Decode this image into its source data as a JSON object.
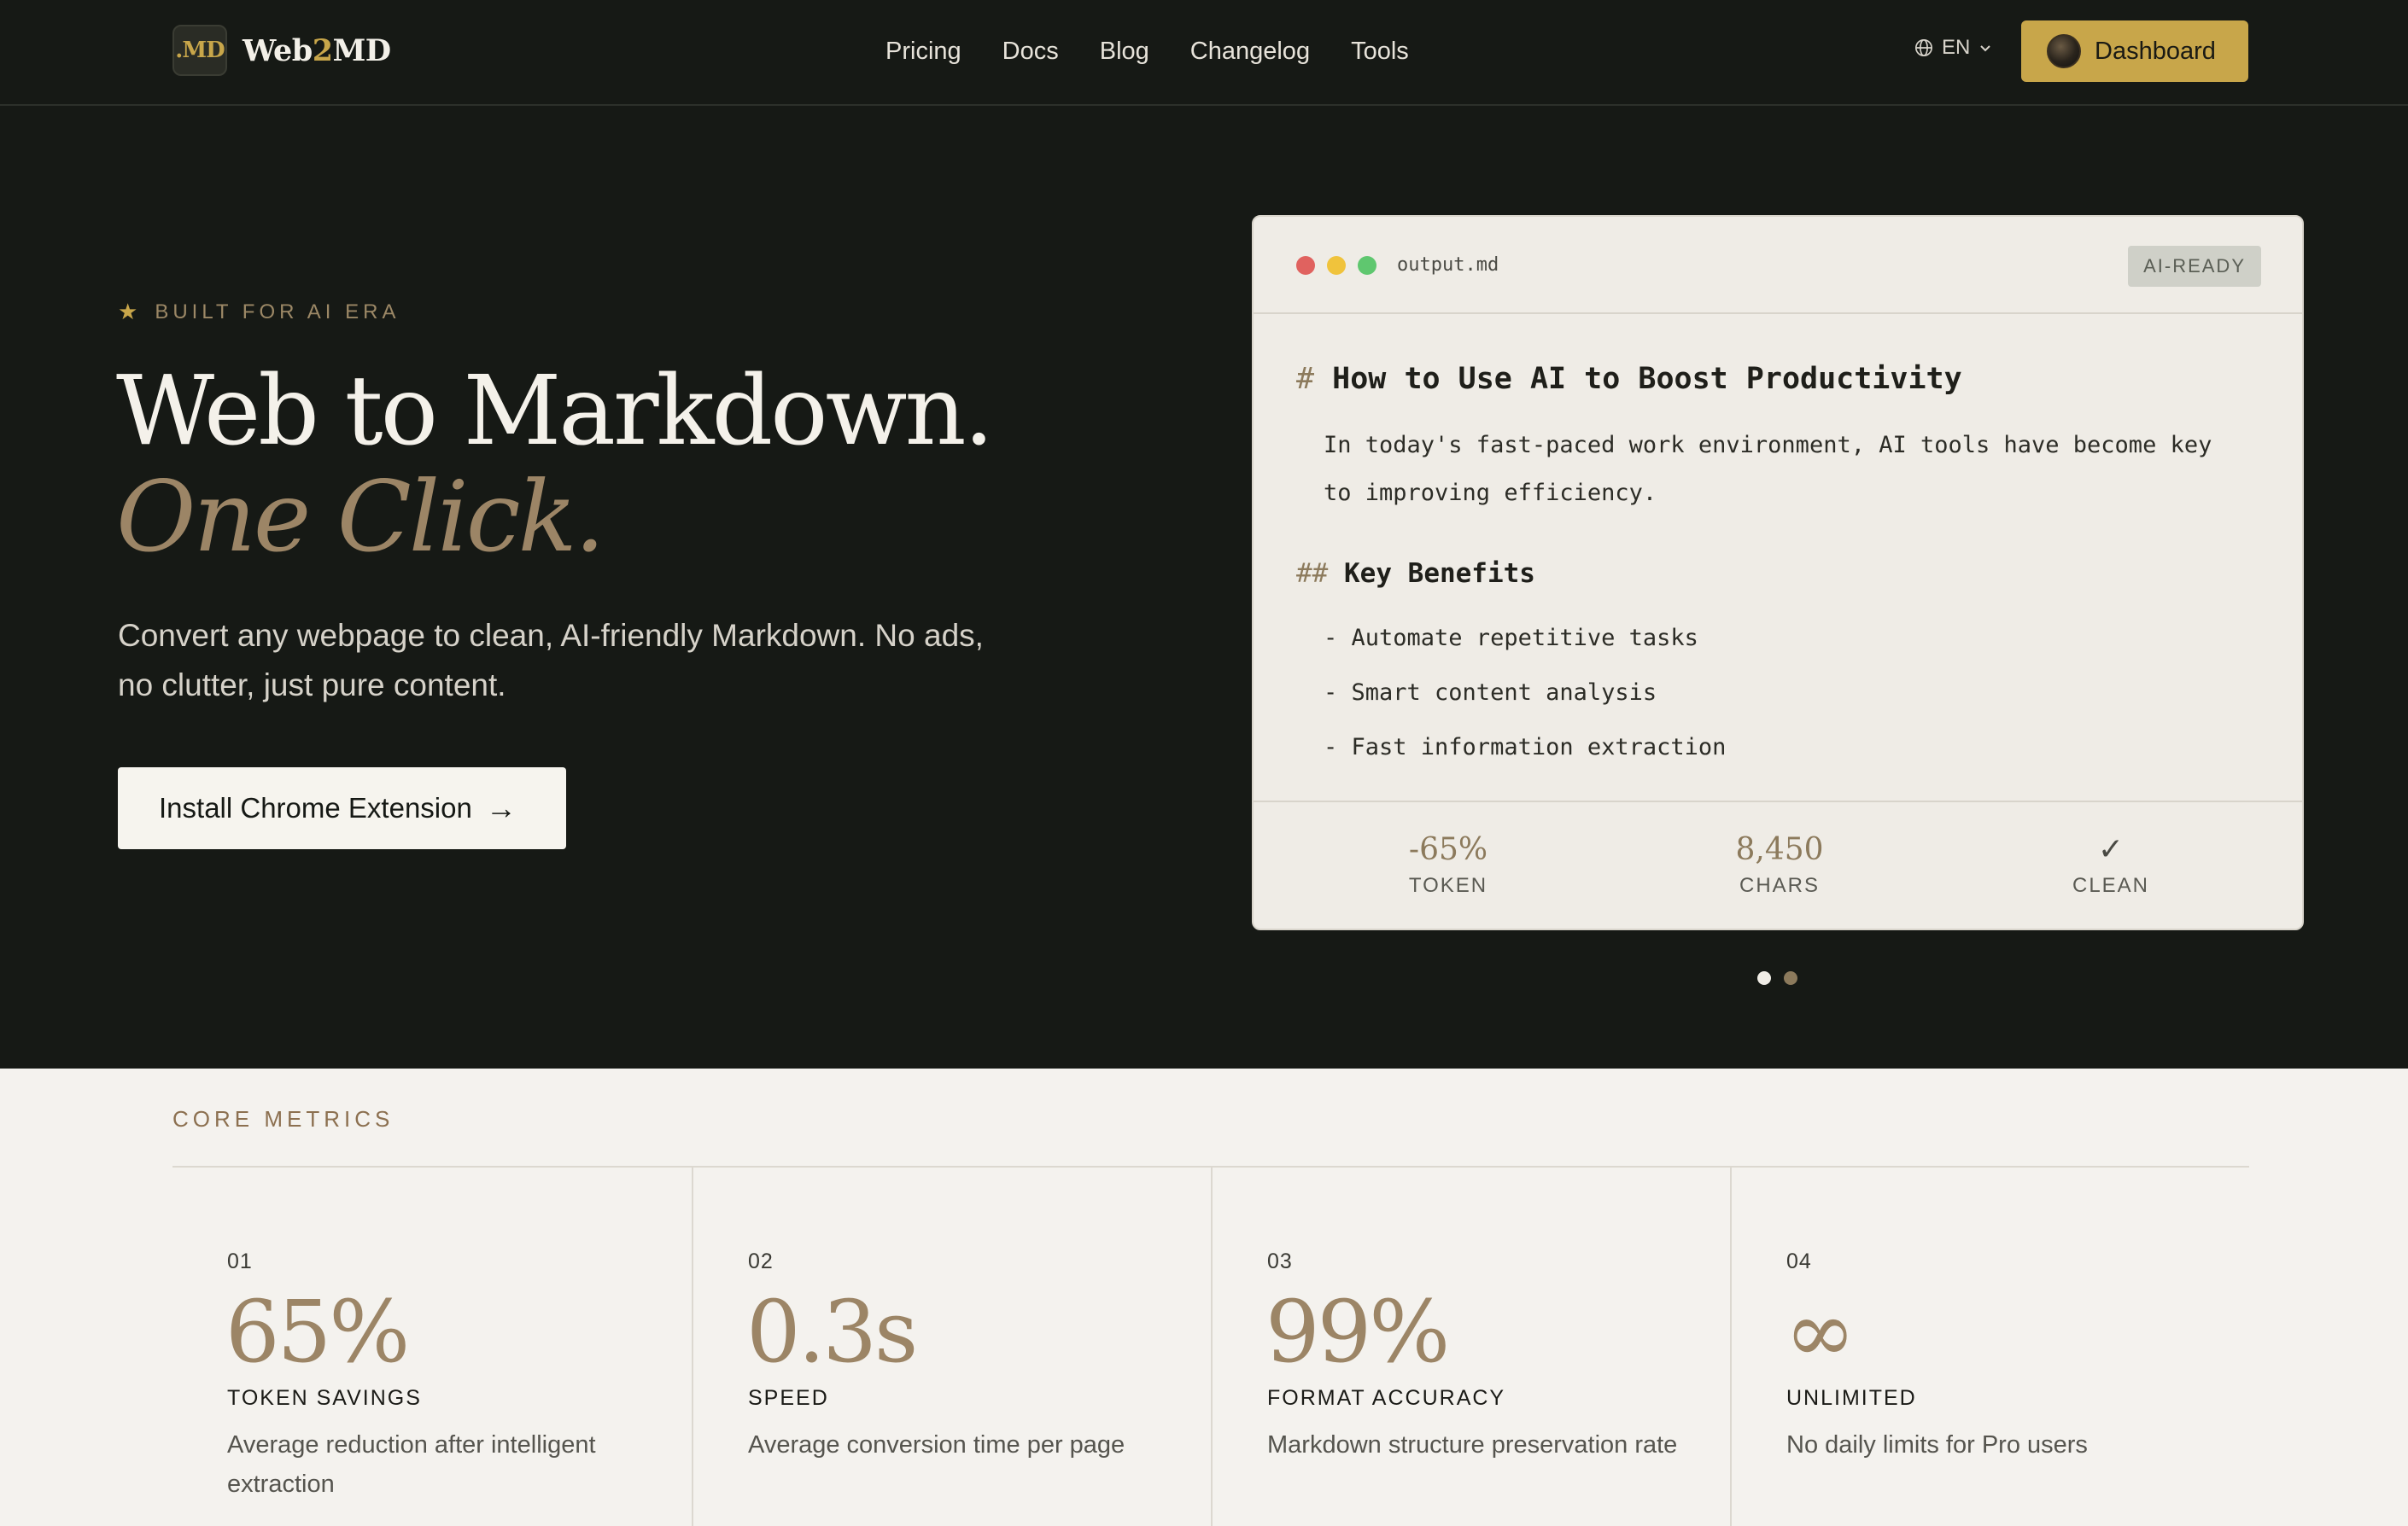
{
  "header": {
    "logo_mark": ".MD",
    "logo_text_a": "Web",
    "logo_text_b": "2",
    "logo_text_c": "MD",
    "nav": [
      "Pricing",
      "Docs",
      "Blog",
      "Changelog",
      "Tools"
    ],
    "lang": "EN",
    "dashboard_label": "Dashboard"
  },
  "hero": {
    "eyebrow": "BUILT FOR AI ERA",
    "title_line1": "Web to Markdown.",
    "title_line2": "One Click.",
    "description": "Convert any webpage to clean, AI-friendly Markdown. No ads, no clutter, just pure content.",
    "cta_label": "Install Chrome Extension",
    "cta_arrow": "→"
  },
  "preview": {
    "filename": "output.md",
    "badge": "AI-READY",
    "h1_marker": "#",
    "h1": "How to Use AI to Boost Productivity",
    "para_line1": "In today's fast-paced work environment, AI tools have become key",
    "para_line2": "to improving efficiency.",
    "h2_marker": "##",
    "h2": "Key Benefits",
    "list": [
      "- Automate repetitive tasks",
      "- Smart content analysis",
      "- Fast information extraction"
    ],
    "stats": [
      {
        "value": "-65%",
        "label": "TOKEN"
      },
      {
        "value": "8,450",
        "label": "CHARS"
      },
      {
        "value": "✓",
        "label": "CLEAN"
      }
    ],
    "active_slide": 1,
    "slide_count": 2
  },
  "metrics": {
    "label": "CORE METRICS",
    "items": [
      {
        "num": "01",
        "value": "65%",
        "title": "TOKEN SAVINGS",
        "desc": "Average reduction after intelligent extraction"
      },
      {
        "num": "02",
        "value": "0.3s",
        "title": "SPEED",
        "desc": "Average conversion time per page"
      },
      {
        "num": "03",
        "value": "99%",
        "title": "FORMAT ACCURACY",
        "desc": "Markdown structure preservation rate"
      },
      {
        "num": "04",
        "value": "∞",
        "title": "UNLIMITED",
        "desc": "No daily limits for Pro users"
      }
    ]
  },
  "colors": {
    "background": "#161915",
    "accent_gold": "#c8a64a",
    "accent_bronze": "#9c8566",
    "light_panel": "#f4f2ee"
  }
}
